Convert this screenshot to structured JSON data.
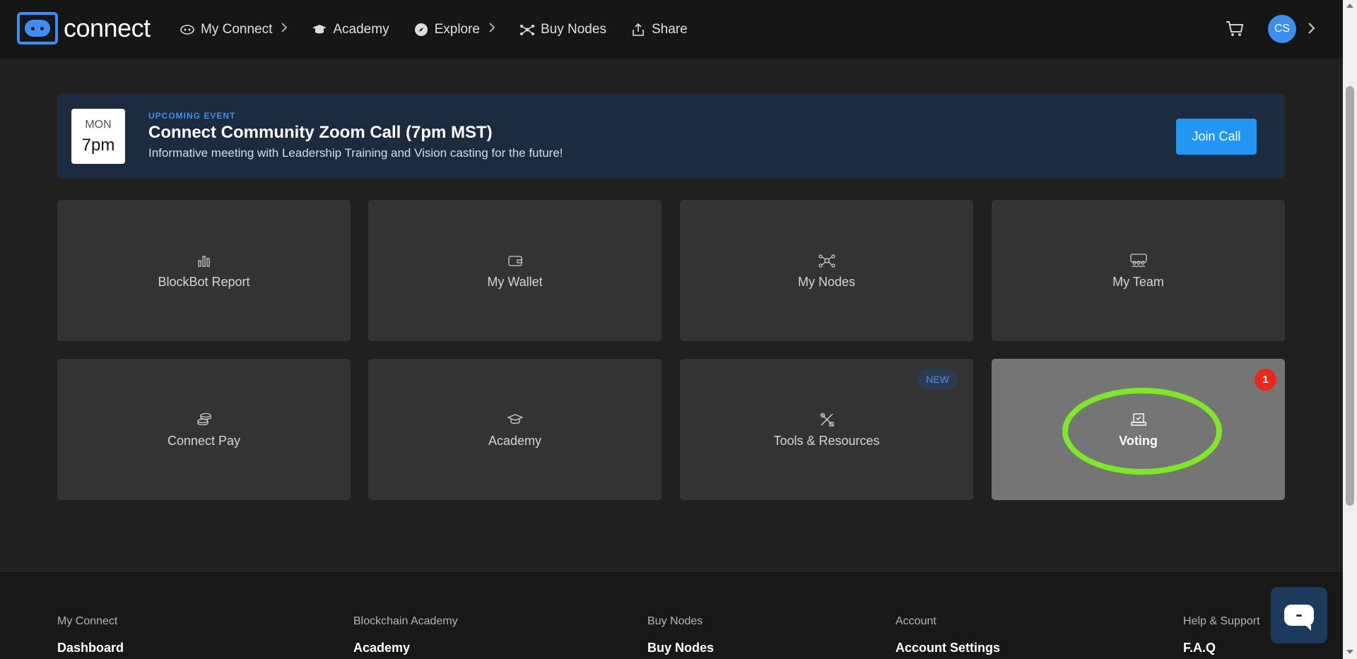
{
  "app": {
    "logo_text": "connect"
  },
  "nav": [
    {
      "label": "My Connect",
      "icon": "eye-icon",
      "has_chevron": true
    },
    {
      "label": "Academy",
      "icon": "graduation-cap-icon",
      "has_chevron": false
    },
    {
      "label": "Explore",
      "icon": "compass-icon",
      "has_chevron": true
    },
    {
      "label": "Buy Nodes",
      "icon": "nodes-icon",
      "has_chevron": false
    },
    {
      "label": "Share",
      "icon": "share-icon",
      "has_chevron": false
    }
  ],
  "header": {
    "avatar_initials": "CS",
    "cart_icon": "cart-icon"
  },
  "event": {
    "day": "MON",
    "time": "7pm",
    "tag": "UPCOMING EVENT",
    "title": "Connect Community Zoom Call (7pm MST)",
    "description": "Informative meeting with Leadership Training and Vision casting for the future!",
    "button_label": "Join Call"
  },
  "tiles": [
    {
      "label": "BlockBot Report",
      "icon": "bar-chart-icon"
    },
    {
      "label": "My Wallet",
      "icon": "wallet-icon"
    },
    {
      "label": "My Nodes",
      "icon": "nodes-icon"
    },
    {
      "label": "My Team",
      "icon": "team-icon"
    },
    {
      "label": "Connect Pay",
      "icon": "coins-icon"
    },
    {
      "label": "Academy",
      "icon": "graduation-cap-icon"
    },
    {
      "label": "Tools & Resources",
      "icon": "tools-icon",
      "badge": "NEW"
    },
    {
      "label": "Voting",
      "icon": "ballot-icon",
      "count": "1",
      "active": true
    }
  ],
  "footer": {
    "columns": [
      {
        "heading": "My Connect",
        "link": "Dashboard"
      },
      {
        "heading": "Blockchain Academy",
        "link": "Academy"
      },
      {
        "heading": "Buy Nodes",
        "link": "Buy Nodes"
      },
      {
        "heading": "Account",
        "link": "Account Settings"
      },
      {
        "heading": "Help & Support",
        "link": "F.A.Q"
      }
    ]
  },
  "colors": {
    "accent": "#3d8ef0",
    "button": "#2196f3",
    "highlight": "#7de82a",
    "badge_red": "#e8281a"
  }
}
